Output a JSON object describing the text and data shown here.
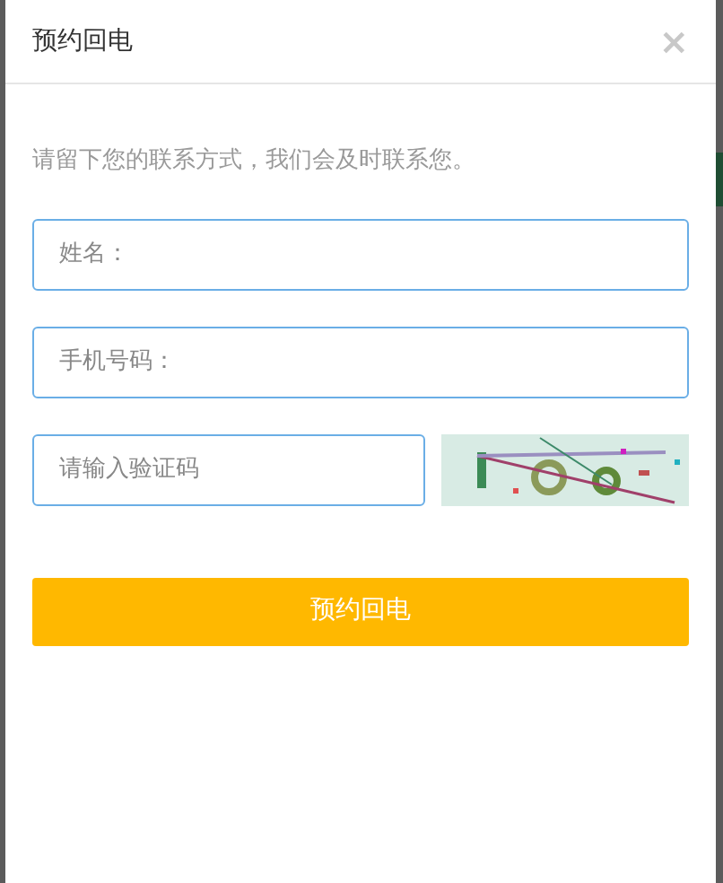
{
  "dialog": {
    "title": "预约回电",
    "close": "×"
  },
  "intro": "请留下您的联系方式，我们会及时联系您。",
  "fields": [
    {
      "placeholder": "姓名："
    },
    {
      "placeholder": "手机号码："
    }
  ],
  "captcha": {
    "placeholder": "请输入验证码"
  },
  "submit": "预约回电"
}
